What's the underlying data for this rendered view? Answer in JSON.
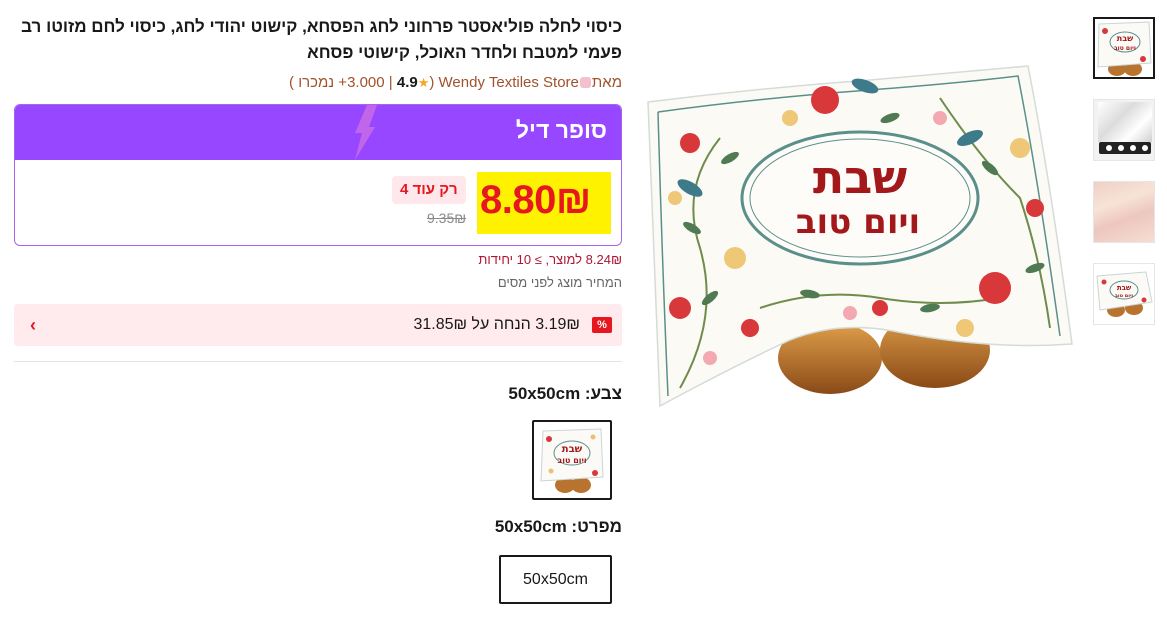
{
  "product": {
    "title": "כיסוי לחלה פוליאסטר פרחוני לחג הפסחא, קישוט יהודי לחג, כיסוי לחם מזוטו רב פעמי למטבח ולחדר האוכל, קישוטי פסחא"
  },
  "store": {
    "from_label": "מאת",
    "name": "Wendy Textiles Store",
    "rating": "4.9",
    "rating_suffix": "+",
    "sold_count": "3.000",
    "sold_label": "נמכרו",
    "open_paren": "(",
    "close_paren": ")",
    "separator": "|"
  },
  "deal": {
    "label": "סופר דיל",
    "price": "8.80₪",
    "old_price": "9.35₪",
    "stock_badge": "רק עוד 4",
    "bulk_text": "8.24₪ למוצר, ≥ 10 יחידות",
    "tax_note": "המחיר מוצג לפני מסים"
  },
  "coupon": {
    "badge": "%",
    "text": "3.19₪ הנחה על 31.85₪",
    "chevron": "›"
  },
  "options": {
    "color_label": "צבע: 50x50cm",
    "spec_label": "מפרט: 50x50cm",
    "spec_value": "50x50cm"
  },
  "image_text": {
    "line1": "שבת",
    "line2": "ויום טוב"
  },
  "colors": {
    "accent_purple": "#9747ff",
    "price_red": "#e6171e",
    "highlight_yellow": "#fff200",
    "store_brown": "#a0522d"
  }
}
